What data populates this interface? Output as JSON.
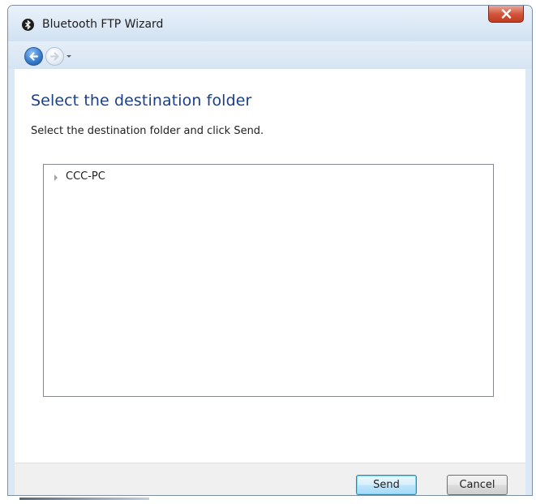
{
  "window": {
    "title": "Bluetooth FTP Wizard"
  },
  "titlebar": {
    "app_icon": "bluetooth-icon",
    "close_icon": "close-icon"
  },
  "nav": {
    "back_icon": "back-arrow-icon",
    "forward_icon": "forward-arrow-icon",
    "history_icon": "chevron-down-icon"
  },
  "main": {
    "heading": "Select the destination folder",
    "instruction": "Select the destination folder and click Send."
  },
  "tree": {
    "items": [
      {
        "label": "CCC-PC",
        "expanded": false
      }
    ]
  },
  "footer": {
    "send_label": "Send",
    "cancel_label": "Cancel"
  },
  "colors": {
    "heading": "#1d3f86",
    "close_button": "#c23b1e",
    "frame": "#dbe8f5"
  }
}
